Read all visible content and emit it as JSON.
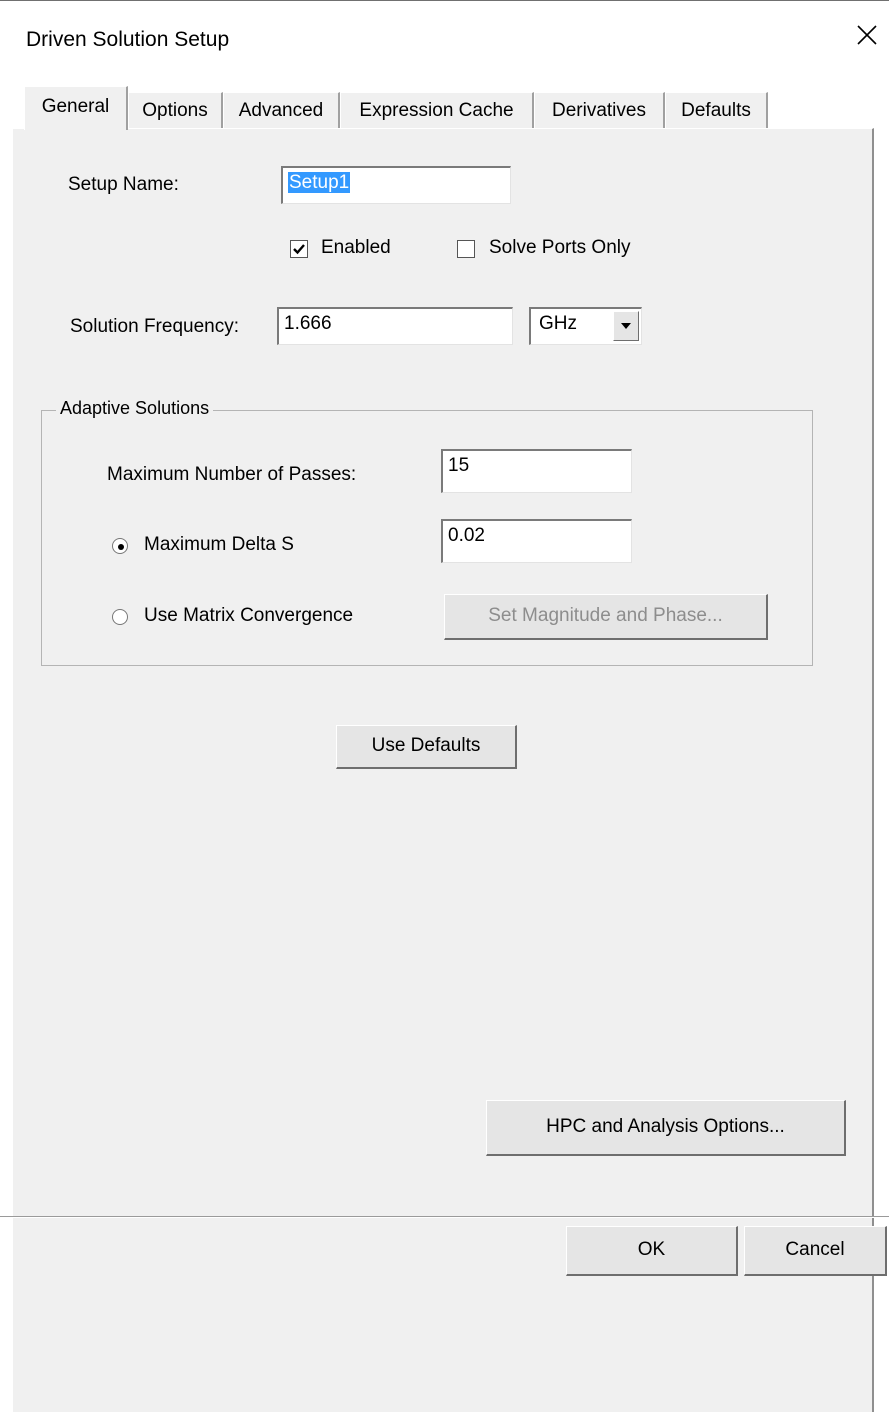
{
  "window": {
    "title": "Driven Solution Setup",
    "close_icon": "close-x-icon"
  },
  "tabs": [
    {
      "label": "General",
      "active": true
    },
    {
      "label": "Options",
      "active": false
    },
    {
      "label": "Advanced",
      "active": false
    },
    {
      "label": "Expression Cache",
      "active": false
    },
    {
      "label": "Derivatives",
      "active": false
    },
    {
      "label": "Defaults",
      "active": false
    }
  ],
  "general": {
    "setup_name_label": "Setup Name:",
    "setup_name_value": "Setup1",
    "enabled_label": "Enabled",
    "enabled_checked": true,
    "solve_ports_only_label": "Solve Ports Only",
    "solve_ports_only_checked": false,
    "solution_frequency_label": "Solution Frequency:",
    "solution_frequency_value": "1.666",
    "frequency_unit": "GHz"
  },
  "adaptive": {
    "group_title": "Adaptive Solutions",
    "max_passes_label": "Maximum Number of Passes:",
    "max_passes_value": "15",
    "max_delta_s_label": "Maximum Delta S",
    "max_delta_s_value": "0.02",
    "max_delta_s_selected": true,
    "matrix_convergence_label": "Use Matrix Convergence",
    "matrix_convergence_selected": false,
    "set_mag_phase_label": "Set Magnitude and Phase..."
  },
  "buttons": {
    "use_defaults": "Use Defaults",
    "hpc_options": "HPC and Analysis Options...",
    "ok": "OK",
    "cancel": "Cancel"
  },
  "colors": {
    "dialog_bg": "#f0f0f0",
    "selection": "#3399ff"
  }
}
